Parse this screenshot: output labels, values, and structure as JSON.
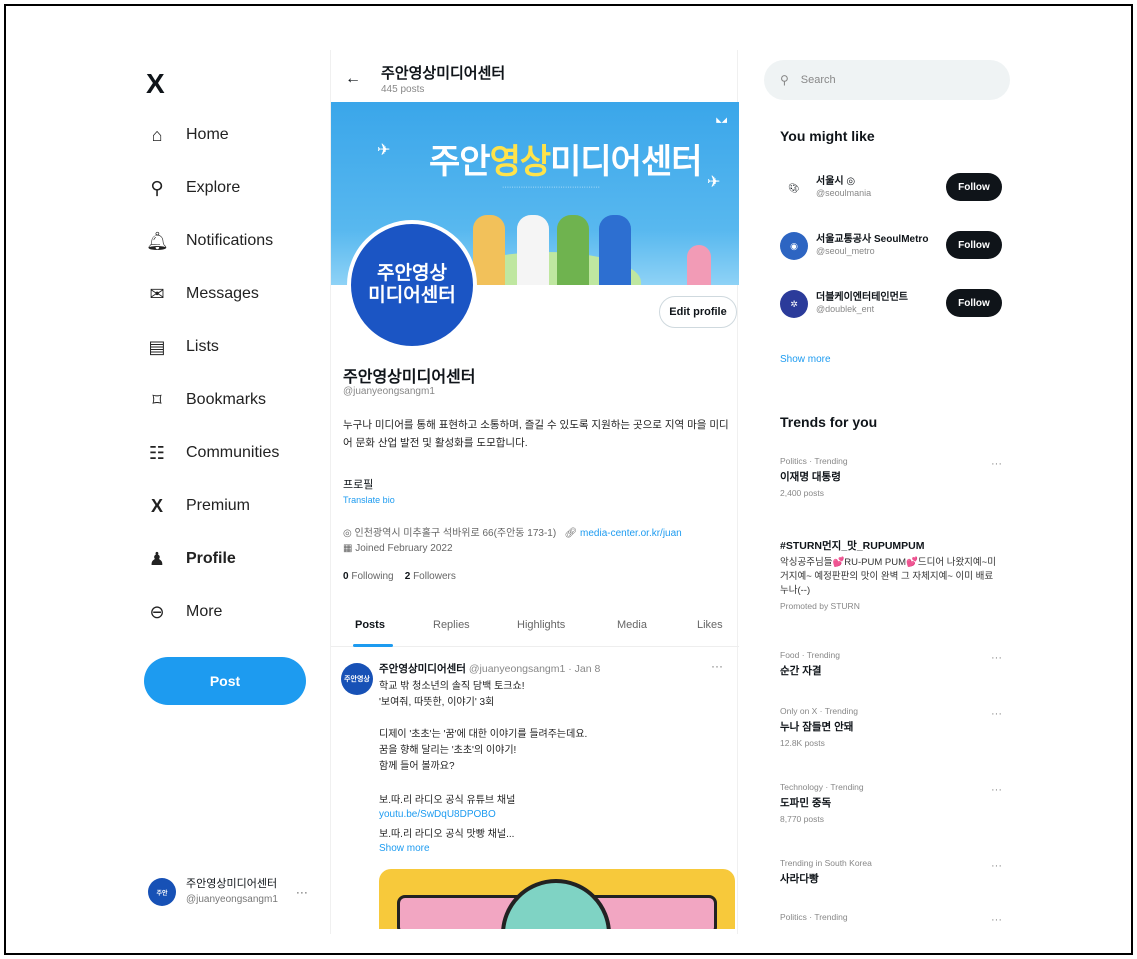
{
  "nav": {
    "logo": "X",
    "items": [
      {
        "label": "Home",
        "icon": "⌂"
      },
      {
        "label": "Explore",
        "icon": "⚲"
      },
      {
        "label": "Notifications",
        "icon": "🔔︎"
      },
      {
        "label": "Messages",
        "icon": "✉"
      },
      {
        "label": "Lists",
        "icon": "▤"
      },
      {
        "label": "Bookmarks",
        "icon": "⌑"
      },
      {
        "label": "Communities",
        "icon": "☷"
      },
      {
        "label": "Premium",
        "icon": "X"
      },
      {
        "label": "Profile",
        "icon": "♟"
      },
      {
        "label": "More",
        "icon": "⊖"
      }
    ],
    "post_label": "Post",
    "account": {
      "name": "주안영상미디어센터",
      "handle": "@juanyeongsangm1",
      "more": "···"
    }
  },
  "topbar": {
    "title": "주안영상미디어센터",
    "posts": "445 posts"
  },
  "banner": {
    "title_a": "주안",
    "title_b": "영상",
    "title_c": "미디어",
    "title_d": "센터"
  },
  "profile": {
    "avatar_text": "주안영상\n미디어센터",
    "edit_label": "Edit profile",
    "name": "주안영상미디어센터",
    "handle": "@juanyeongsangm1",
    "bio": "누구나 미디어를 통해 표현하고 소통하며, 즐길 수 있도록 지원하는 곳으로 지역 마을 미디어 문화 산업 발전 및 활성화를 도모합니다.",
    "label": "프로필",
    "translate": "Translate bio",
    "location": "인천광역시 미추홀구 석바위로 66(주안동 173-1)",
    "website": "media-center.or.kr/juan",
    "joined": "Joined February 2022",
    "following_count": "0",
    "following_label": "Following",
    "followers_count": "2",
    "followers_label": "Followers"
  },
  "tabs": [
    "Posts",
    "Replies",
    "Highlights",
    "Media",
    "Likes"
  ],
  "tweet": {
    "avatar": "주안영상",
    "name": "주안영상미디어센터",
    "meta": "@juanyeongsangm1 · Jan 8",
    "more": "···",
    "lines": [
      "학교 밖 청소년의 솔직 담백 토크쇼!",
      "'보여줘, 따뜻한, 이야기' 3회",
      "",
      "디제이 '초초'는 '꿈'에 대한 이야기를 들려주는데요.",
      "꿈을 향해 달리는 '초초'의 이야기!",
      "함께 들어 볼까요?",
      "",
      "보.따.리 라디오 공식 유튜브 채널"
    ],
    "link": "youtu.be/SwDqU8DPOBO",
    "last_line": "보.따.리 라디오 공식 맛빵 채널...",
    "show_more": "Show more"
  },
  "right": {
    "search_placeholder": "Search",
    "you_might_like": "You might like",
    "suggestions": [
      {
        "name": "서울시 ◎",
        "handle": "@seoulmania",
        "follow": "Follow",
        "bg": "#ffffff"
      },
      {
        "name": "서울교통공사 SeoulMetro",
        "handle": "@seoul_metro",
        "follow": "Follow",
        "bg": "#2d65c2"
      },
      {
        "name": "더블케이엔터테인먼트",
        "handle": "@doublek_ent",
        "follow": "Follow",
        "bg": "#2b3b9a"
      }
    ],
    "show_more": "Show more",
    "trends_title": "Trends for you",
    "trends": [
      {
        "meta": "Politics · Trending",
        "name": "이재명 대통령",
        "count": "2,400 posts"
      },
      {
        "meta": "Food · Trending",
        "name": "순간 자결",
        "count": ""
      },
      {
        "meta": "Only on X · Trending",
        "name": "누나 잠들면 안돼",
        "count": "12.8K posts"
      },
      {
        "meta": "Technology · Trending",
        "name": "도파민 중독",
        "count": "8,770 posts"
      },
      {
        "meta": "Trending in South Korea",
        "name": "사라다빵",
        "count": ""
      },
      {
        "meta": "Politics · Trending",
        "name": "",
        "count": ""
      }
    ],
    "promo": {
      "name": "#STURN먼지_맛_RUPUMPUM",
      "desc": "악싱공주님들💕RU-PUM PUM💕드디어 나왔지예~미거지예~ 예정판판의 맛이 완벽 그 자체지예~ 이미 배료 누나(--)",
      "meta": "Promoted by STURN"
    }
  }
}
